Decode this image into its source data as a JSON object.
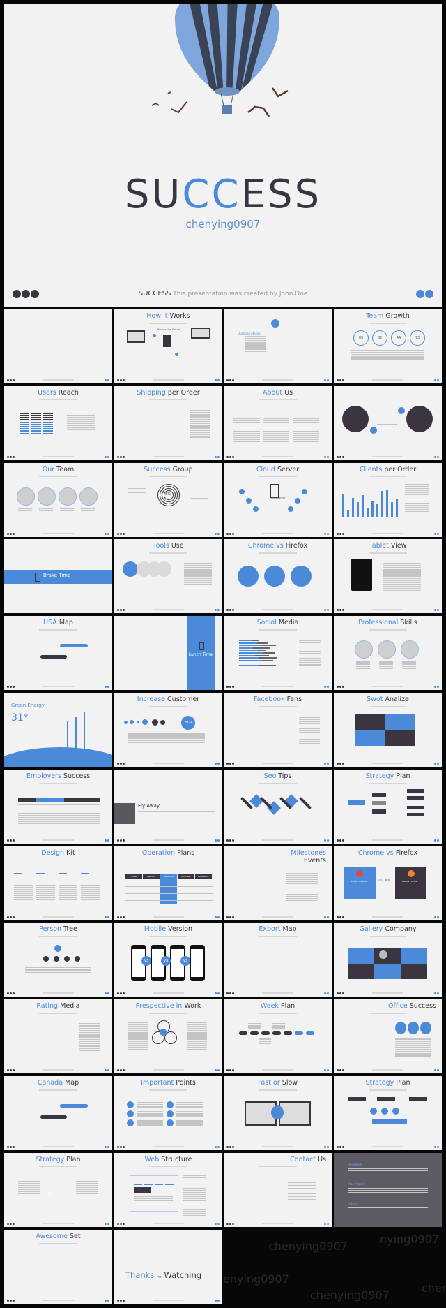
{
  "colors": {
    "accent": "#4a8ad8",
    "dark": "#3a3540",
    "slide_bg": "#f2f2f2",
    "background": "#070707"
  },
  "cover": {
    "title_start": "SU",
    "title_c1": "C",
    "title_c2": "C",
    "title_end": "ESS",
    "subtitle": "chenying0907",
    "footer_brand": "SUCCESS",
    "footer_text": "This presentation was created by John Doe"
  },
  "watermarks": [
    "chenying0907",
    "enying0907",
    "chenying0907",
    "nying0907",
    "chen"
  ],
  "slides": [
    {
      "a": "",
      "b": "",
      "kind": "blank"
    },
    {
      "a": "How it",
      "b": "Works",
      "kind": "devices",
      "label": "Responsive Design"
    },
    {
      "a": "",
      "b": "",
      "kind": "question",
      "label": "Question of Day"
    },
    {
      "a": "Team",
      "b": "Growth",
      "kind": "rings",
      "values": [
        "65",
        "82",
        "44",
        "73"
      ]
    },
    {
      "a": "Users",
      "b": "Reach",
      "kind": "stack"
    },
    {
      "a": "Shipping",
      "b": "per Order",
      "kind": "line"
    },
    {
      "a": "About",
      "b": "Us",
      "kind": "columns"
    },
    {
      "a": "",
      "b": "",
      "kind": "darkcircles"
    },
    {
      "a": "Our",
      "b": "Team",
      "kind": "graycircles4"
    },
    {
      "a": "Success",
      "b": "Group",
      "kind": "donut",
      "label": "78%"
    },
    {
      "a": "Cloud",
      "b": "Server",
      "kind": "network",
      "label": "Cloud Server"
    },
    {
      "a": "Clients",
      "b": "per Order",
      "kind": "bars"
    },
    {
      "a": "",
      "b": "",
      "kind": "band",
      "label": "Brake Time"
    },
    {
      "a": "Tools",
      "b": "Use",
      "kind": "tools"
    },
    {
      "a": "Chrome vs",
      "b": "Firefox",
      "kind": "bluecircles3"
    },
    {
      "a": "Tablet",
      "b": "View",
      "kind": "tablet"
    },
    {
      "a": "USA",
      "b": "Map",
      "kind": "map"
    },
    {
      "a": "",
      "b": "",
      "kind": "vband",
      "label": "Lunch Time"
    },
    {
      "a": "Social",
      "b": "Media",
      "kind": "hbars"
    },
    {
      "a": "Professional",
      "b": "Skills",
      "kind": "graycircles3"
    },
    {
      "a": "",
      "b": "",
      "kind": "hill",
      "label": "Green Energy",
      "value": "31°"
    },
    {
      "a": "Increase",
      "b": "Customer",
      "kind": "timeline",
      "label": "2014"
    },
    {
      "a": "Facebook",
      "b": "Fans",
      "kind": "area"
    },
    {
      "a": "Swot",
      "b": "Analize",
      "kind": "swot"
    },
    {
      "a": "Employers",
      "b": "Success",
      "kind": "table3"
    },
    {
      "a": "",
      "b": "",
      "kind": "flyaway",
      "label": "Fly Away"
    },
    {
      "a": "Seo",
      "b": "Tips",
      "kind": "diamonds"
    },
    {
      "a": "Strategy",
      "b": "Plan",
      "kind": "flow"
    },
    {
      "a": "Design",
      "b": "Kit",
      "kind": "columns4"
    },
    {
      "a": "Operation",
      "b": "Plans",
      "kind": "pricing",
      "headers": [
        "Small",
        "Medium",
        "Medium+",
        "Business",
        "Business+"
      ]
    },
    {
      "a": "Milestones",
      "b": "Events",
      "kind": "milestones"
    },
    {
      "a": "Chrome vs",
      "b": "Firefox",
      "kind": "browsers",
      "labels": [
        "Google Chrome",
        "Mozilla Firefox"
      ],
      "values": [
        "43%",
        "28%"
      ]
    },
    {
      "a": "Person",
      "b": "Tree",
      "kind": "tree"
    },
    {
      "a": "Mobile",
      "b": "Version",
      "kind": "phones",
      "label": "VS"
    },
    {
      "a": "Export",
      "b": "Map",
      "kind": "map"
    },
    {
      "a": "Gallery",
      "b": "Company",
      "kind": "gallery"
    },
    {
      "a": "Rating",
      "b": "Media",
      "kind": "line"
    },
    {
      "a": "Prespective in",
      "b": "Work",
      "kind": "venn"
    },
    {
      "a": "Week",
      "b": "Plan",
      "kind": "week"
    },
    {
      "a": "Office",
      "b": "Success",
      "kind": "bluecircles3small"
    },
    {
      "a": "Canada",
      "b": "Map",
      "kind": "map"
    },
    {
      "a": "Important",
      "b": "Points",
      "kind": "points"
    },
    {
      "a": "Fast or",
      "b": "Slow",
      "kind": "monitors"
    },
    {
      "a": "Strategy",
      "b": "Plan",
      "kind": "flow"
    },
    {
      "a": "Strategy",
      "b": "Plan",
      "kind": "pie",
      "label": "56%"
    },
    {
      "a": "Web",
      "b": "Structure",
      "kind": "web"
    },
    {
      "a": "Contact",
      "b": "Us",
      "kind": "contact"
    },
    {
      "a": "",
      "b": "",
      "kind": "dark",
      "labels": [
        "Research",
        "Main Point",
        "Article"
      ]
    },
    {
      "a": "Awesome",
      "b": "Set",
      "kind": "blank"
    },
    {
      "a": "Thanks",
      "b": "Watching",
      "kind": "thanks",
      "mid": "for"
    }
  ]
}
